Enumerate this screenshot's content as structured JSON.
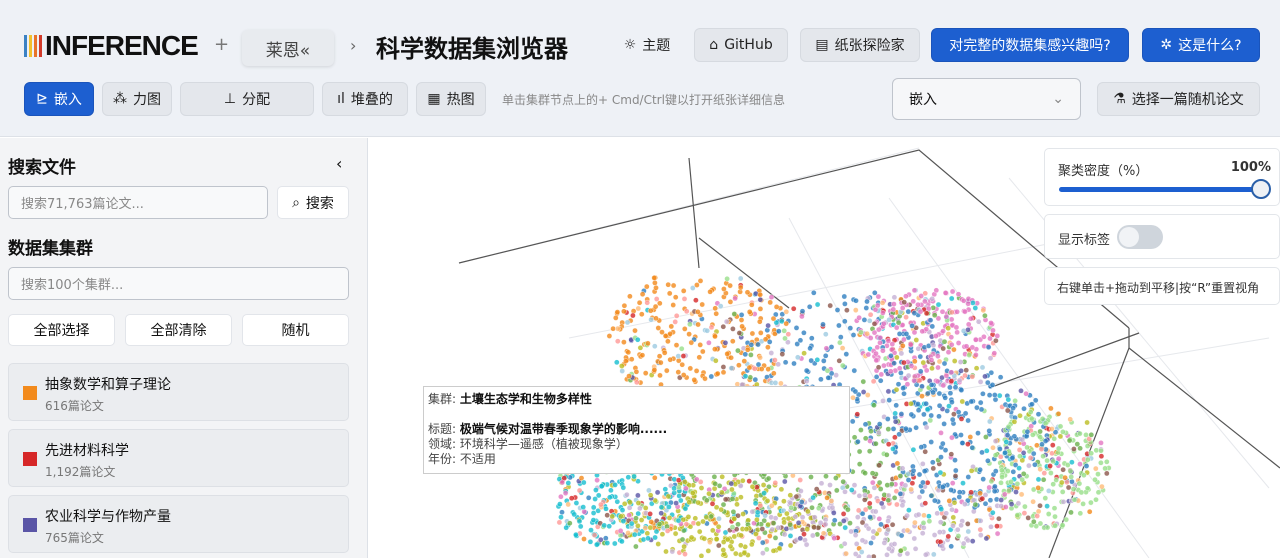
{
  "header": {
    "logo": "INFERENCE",
    "plus": "+",
    "user": "莱恩«",
    "breadcrumb_sep": "›",
    "title": "科学数据集浏览器",
    "theme": "主题",
    "github": "GitHub",
    "paper_explorer": "纸张探险家",
    "full_dataset": "对完整的数据集感兴趣吗?",
    "what_is": "这是什么?"
  },
  "toolbar": {
    "tabs": [
      {
        "label": "嵌入",
        "icon": "embed-icon"
      },
      {
        "label": "力图",
        "icon": "graph-icon"
      },
      {
        "label": "分配",
        "icon": "bar-chart-icon"
      },
      {
        "label": "堆叠的",
        "icon": "signal-icon"
      },
      {
        "label": "热图",
        "icon": "grid-icon"
      }
    ],
    "hint": "单击集群节点上的+ Cmd/Ctrl键以打开纸张详细信息",
    "select_value": "嵌入",
    "random_paper": "选择一篇随机论文"
  },
  "sidebar": {
    "search_title": "搜索文件",
    "search_placeholder": "搜索71,763篇论文...",
    "search_button": "搜索",
    "clusters_title": "数据集集群",
    "cluster_placeholder": "搜索100个集群...",
    "select_all": "全部选择",
    "clear_all": "全部清除",
    "random": "随机",
    "clusters": [
      {
        "name": "抽象数学和算子理论",
        "count": "616篇论文",
        "color": "#f28a1c"
      },
      {
        "name": "先进材料科学",
        "count": "1,192篇论文",
        "color": "#d62728"
      },
      {
        "name": "农业科学与作物产量",
        "count": "765篇论文",
        "color": "#5a55a6"
      }
    ]
  },
  "controls": {
    "density_label": "聚类密度（%）",
    "density_value": "100%",
    "density": 1.0,
    "show_labels": "显示标签",
    "show_labels_on": false,
    "nav_hint": "右键单击+拖动到平移|按“R”重置视角"
  },
  "tooltip": {
    "cluster_label": "集群:",
    "cluster": "土壤生态学和生物多样性",
    "title_label": "标题:",
    "title": "极端气候对温带春季现象学的影响......",
    "field_label": "领域:",
    "field": "环境科学—遥感（植被现象学）",
    "year_label": "年份:",
    "year": "不适用"
  },
  "palette": [
    "#f28a1c",
    "#d62728",
    "#5a55a6",
    "#2f7fc1",
    "#6ab04c",
    "#e377c2",
    "#bcbd22",
    "#17becf",
    "#8c564b",
    "#9ecae1",
    "#ffbb78",
    "#98df8a",
    "#c5b0d5",
    "#ff9896"
  ]
}
